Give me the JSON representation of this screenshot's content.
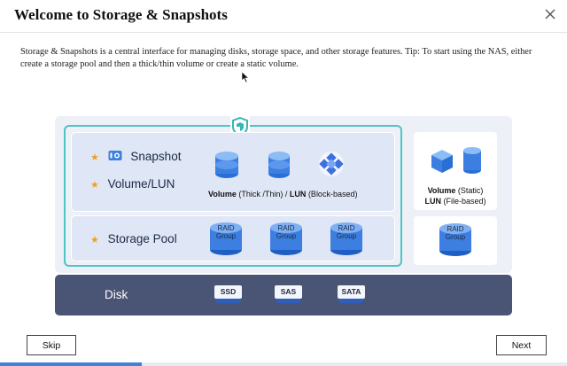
{
  "dialog": {
    "title": "Welcome to Storage & Snapshots",
    "description": "Storage & Snapshots is a central interface for managing disks, storage space, and other storage features. Tip: To start using the NAS, either create a storage pool and then a thick/thin volume or create a static volume."
  },
  "diagram": {
    "snapshot_label": "Snapshot",
    "volume_lun_label": "Volume/LUN",
    "storage_pool_label": "Storage Pool",
    "volume_bold": "Volume",
    "volume_type": "(Thick /Thin)",
    "lun_sep": "/",
    "lun_bold": "LUN",
    "lun_type": "(Block-based)",
    "static_volume_bold": "Volume",
    "static_volume_type": "(Static)",
    "file_lun_bold": "LUN",
    "file_lun_type": "(File-based)",
    "raid_line1": "RAID",
    "raid_line2": "Group",
    "disk_label": "Disk",
    "disk_types": [
      "SSD",
      "SAS",
      "SATA"
    ]
  },
  "buttons": {
    "skip": "Skip",
    "next": "Next"
  },
  "progress": {
    "fraction": 0.25
  },
  "colors": {
    "accent_teal": "#4fc4c4",
    "disk_bar": "#4a5474",
    "icon_blue": "#3d7fe0",
    "star": "#f0a020"
  },
  "icons": [
    "close-icon",
    "shield-icon",
    "snapshot-icon",
    "database-icon",
    "cluster-icon",
    "cube-icon",
    "cylinder-icon",
    "raid-group-icon",
    "disk-chip-icon",
    "mouse-cursor-icon"
  ]
}
